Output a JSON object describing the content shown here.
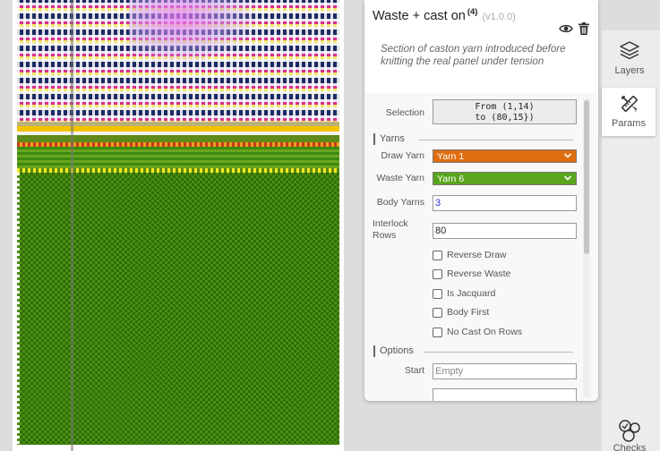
{
  "panel": {
    "title": "Waste + cast on",
    "count": "(4)",
    "version": "(v1.0.0)",
    "description": "Section of caston yarn introduced before knitting the real panel under tension"
  },
  "params": {
    "selection_label": "Selection",
    "selection_line1": "From (1,14)",
    "selection_line2": "to (80,15})",
    "yarns_section": "Yarns",
    "draw_yarn_label": "Draw Yarn",
    "draw_yarn_value": "Yarn 1",
    "draw_yarn_color": "#e06e10",
    "waste_yarn_label": "Waste Yarn",
    "waste_yarn_value": "Yarn 6",
    "waste_yarn_color": "#5aa51e",
    "body_yarns_label": "Body Yarns",
    "body_yarns_value": "3",
    "interlock_rows_label": "Interlock\nRows",
    "interlock_rows_value": "80",
    "checkboxes": [
      "Reverse Draw",
      "Reverse Waste",
      "Is Jacquard",
      "Body First",
      "No Cast On Rows"
    ],
    "options_section": "Options",
    "start_label": "Start",
    "start_placeholder": "Empty"
  },
  "toolbar": {
    "layers_label": "Layers",
    "params_label": "Params",
    "checks_label": "Checks"
  },
  "colors": {
    "draw_yarn": "#e06e10",
    "waste_yarn": "#5aa51e"
  },
  "icons": [
    "eye-icon",
    "trash-icon",
    "layers-icon",
    "params-icon",
    "checks-icon",
    "chevron-down-icon"
  ]
}
